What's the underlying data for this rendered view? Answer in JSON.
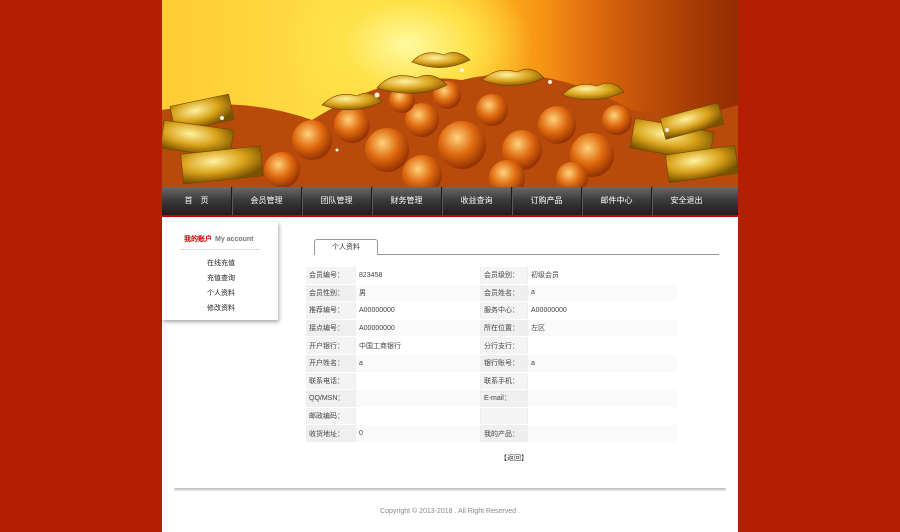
{
  "nav": {
    "items": [
      {
        "label": "首　页"
      },
      {
        "label": "会员管理"
      },
      {
        "label": "团队管理"
      },
      {
        "label": "财务管理"
      },
      {
        "label": "收益查询"
      },
      {
        "label": "订购产品"
      },
      {
        "label": "邮件中心"
      },
      {
        "label": "安全退出"
      }
    ]
  },
  "sidebar": {
    "title_cn": "我的账户",
    "title_en": "My account",
    "links": [
      {
        "label": "在线充值"
      },
      {
        "label": "充值查询"
      },
      {
        "label": "个人资料"
      },
      {
        "label": "修改资料"
      }
    ]
  },
  "content": {
    "tab_label": "个人资料",
    "rows": [
      {
        "l1": "会员编号：",
        "v1": "823458",
        "l2": "会员级别：",
        "v2": " 初级会员"
      },
      {
        "l1": "会员性别：",
        "v1": "男",
        "l2": "会员姓名：",
        "v2": "a"
      },
      {
        "l1": "推荐编号：",
        "v1": "A00000000",
        "l2": "服务中心：",
        "v2": "A00000000"
      },
      {
        "l1": "接点编号：",
        "v1": "A00000000",
        "l2": "所在位置：",
        "v2": "左区"
      },
      {
        "l1": "开户银行：",
        "v1": "中国工商银行",
        "l2": "分行支行：",
        "v2": ""
      },
      {
        "l1": "开户姓名：",
        "v1": "a",
        "l2": "银行账号：",
        "v2": "a"
      },
      {
        "l1": "联系电话：",
        "v1": "",
        "l2": "联系手机：",
        "v2": ""
      },
      {
        "l1": "QQ/MSN：",
        "v1": "",
        "l2": "E-mail：",
        "v2": ""
      },
      {
        "l1": "邮政编码：",
        "v1": "",
        "l2": "",
        "v2": ""
      },
      {
        "l1": "收货地址：",
        "v1": "0",
        "l2": "我的产品：",
        "v2": ""
      }
    ],
    "back_label": "【返回】"
  },
  "footer": {
    "copyright": "Copyright © 2013-2018 . All Right Reserved ."
  }
}
